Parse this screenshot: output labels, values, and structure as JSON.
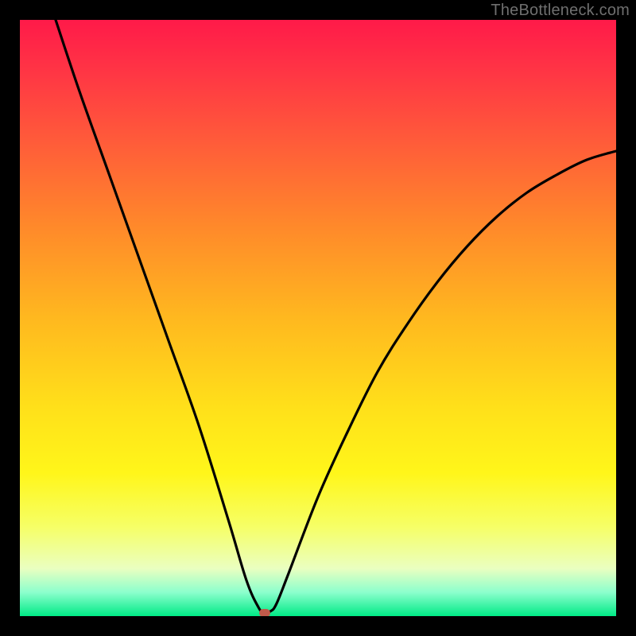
{
  "watermark": "TheBottleneck.com",
  "chart_data": {
    "type": "line",
    "title": "",
    "xlabel": "",
    "ylabel": "",
    "xlim": [
      0,
      100
    ],
    "ylim": [
      0,
      100
    ],
    "grid": false,
    "series": [
      {
        "name": "curve",
        "x": [
          6,
          10,
          15,
          20,
          25,
          30,
          35,
          38,
          40,
          41,
          42,
          43,
          45,
          50,
          55,
          60,
          65,
          70,
          75,
          80,
          85,
          90,
          95,
          100
        ],
        "y": [
          100,
          88,
          74,
          60,
          46,
          32,
          16,
          6,
          1.5,
          0.5,
          0.8,
          2,
          7,
          20,
          31,
          41,
          49,
          56,
          62,
          67,
          71,
          74,
          76.5,
          78
        ]
      }
    ],
    "marker": {
      "x": 41,
      "y": 0.5,
      "color": "#c05a4a"
    },
    "gradient_stops": [
      {
        "pos": 0,
        "color": "#ff1a49"
      },
      {
        "pos": 50,
        "color": "#ffe01a"
      },
      {
        "pos": 100,
        "color": "#00ea86"
      }
    ]
  }
}
